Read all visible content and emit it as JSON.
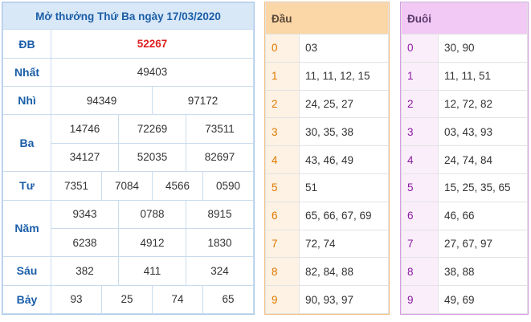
{
  "results": {
    "title": "Mở thưởng Thứ Ba ngày 17/03/2020",
    "rows": {
      "db": {
        "label": "ĐB",
        "values": [
          "52267"
        ]
      },
      "nhat": {
        "label": "Nhất",
        "values": [
          "49403"
        ]
      },
      "nhi": {
        "label": "Nhì",
        "values": [
          "94349",
          "97172"
        ]
      },
      "ba": {
        "label": "Ba",
        "values": [
          "14746",
          "72269",
          "73511",
          "34127",
          "52035",
          "82697"
        ]
      },
      "tu": {
        "label": "Tư",
        "values": [
          "7351",
          "7084",
          "4566",
          "0590"
        ]
      },
      "nam": {
        "label": "Năm",
        "values": [
          "9343",
          "0788",
          "8915",
          "6238",
          "4912",
          "1830"
        ]
      },
      "sau": {
        "label": "Sáu",
        "values": [
          "382",
          "411",
          "324"
        ]
      },
      "bay": {
        "label": "Bảy",
        "values": [
          "93",
          "25",
          "74",
          "65"
        ]
      }
    }
  },
  "dau": {
    "header": "Đầu",
    "rows": [
      {
        "idx": "0",
        "values": "03"
      },
      {
        "idx": "1",
        "values": "11, 11, 12, 15"
      },
      {
        "idx": "2",
        "values": "24, 25, 27"
      },
      {
        "idx": "3",
        "values": "30, 35, 38"
      },
      {
        "idx": "4",
        "values": "43, 46, 49"
      },
      {
        "idx": "5",
        "values": "51"
      },
      {
        "idx": "6",
        "values": "65, 66, 67, 69"
      },
      {
        "idx": "7",
        "values": "72, 74"
      },
      {
        "idx": "8",
        "values": "82, 84, 88"
      },
      {
        "idx": "9",
        "values": "90, 93, 97"
      }
    ]
  },
  "duoi": {
    "header": "Đuôi",
    "rows": [
      {
        "idx": "0",
        "values": "30, 90"
      },
      {
        "idx": "1",
        "values": "11, 11, 51"
      },
      {
        "idx": "2",
        "values": "12, 72, 82"
      },
      {
        "idx": "3",
        "values": "03, 43, 93"
      },
      {
        "idx": "4",
        "values": "24, 74, 84"
      },
      {
        "idx": "5",
        "values": "15, 25, 35, 65"
      },
      {
        "idx": "6",
        "values": "46, 66"
      },
      {
        "idx": "7",
        "values": "27, 67, 97"
      },
      {
        "idx": "8",
        "values": "38, 88"
      },
      {
        "idx": "9",
        "values": "49, 69"
      }
    ]
  },
  "colors": {
    "results_title_bg": "#d9e8f7",
    "prize_label": "#1a5ea8",
    "special_prize": "#e02020",
    "dau_header_bg": "#fbd6a6",
    "dau_index": "#e07800",
    "duoi_header_bg": "#f2c8f5",
    "duoi_index": "#8a1a9e"
  }
}
